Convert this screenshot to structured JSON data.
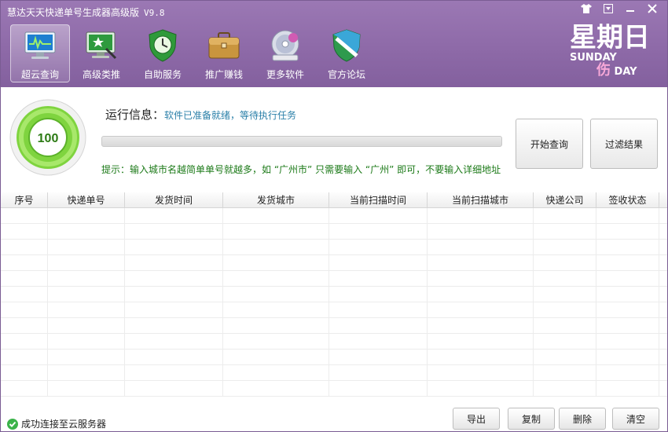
{
  "app": {
    "title": "慧达天天快递单号生成器高级版",
    "version": "V9.8"
  },
  "window_controls": [
    "shirt-icon",
    "dropdown-icon",
    "minimize-icon",
    "close-icon"
  ],
  "toolbar": {
    "items": [
      {
        "label": "超云查询",
        "icon": "monitor-icon",
        "active": true
      },
      {
        "label": "高级类推",
        "icon": "screen-star-icon",
        "active": false
      },
      {
        "label": "自助服务",
        "icon": "clock-shield-icon",
        "active": false
      },
      {
        "label": "推广赚钱",
        "icon": "briefcase-icon",
        "active": false
      },
      {
        "label": "更多软件",
        "icon": "disc-icon",
        "active": false
      },
      {
        "label": "官方论坛",
        "icon": "shield-icon",
        "active": false
      }
    ]
  },
  "day_art": {
    "cn": "星期日",
    "en": "SUNDAY",
    "pink": "伤",
    "en2": "DAY"
  },
  "info": {
    "score": "100",
    "run_label": "运行信息：",
    "run_status": "软件已准备就绪，等待执行任务",
    "progress": 0,
    "tip": "提示：输入城市名越简单单号就越多，如 “广州市” 只需要输入 “广州” 即可，不要输入详细地址",
    "btn_start": "开始查询",
    "btn_filter": "过滤结果"
  },
  "table": {
    "columns": [
      "序号",
      "快递单号",
      "发货时间",
      "发货城市",
      "当前扫描时间",
      "当前扫描城市",
      "快递公司",
      "签收状态"
    ],
    "rows": []
  },
  "footer": {
    "connection": "成功连接至云服务器",
    "btn_export": "导出",
    "btn_copy": "复制",
    "btn_delete": "删除",
    "btn_clear": "清空"
  },
  "colors": {
    "header": "#8e6aa8",
    "accent_green": "#6fcf3c",
    "tip_green": "#1c7a18",
    "status_blue": "#2a7fa8"
  }
}
